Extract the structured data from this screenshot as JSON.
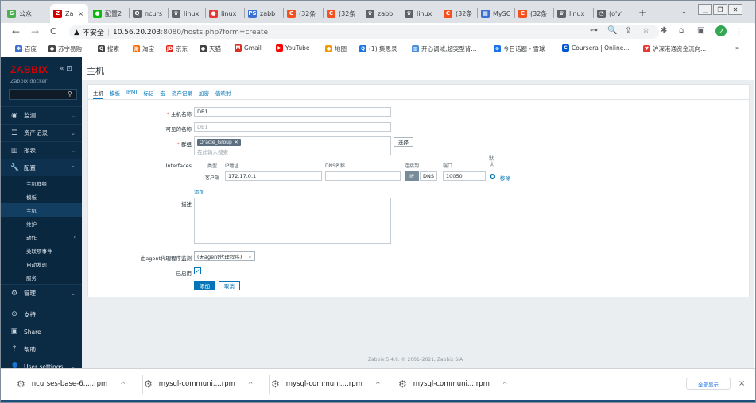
{
  "browser": {
    "tabs": [
      {
        "label": "公众",
        "fav": "G",
        "color": "#4caf50"
      },
      {
        "label": "Za",
        "fav": "Z",
        "color": "#d40000",
        "active": true
      },
      {
        "label": "配置2",
        "fav": "●",
        "color": "#09bb07"
      },
      {
        "label": "ncurs",
        "fav": "Q",
        "color": "#5f6368"
      },
      {
        "label": "linux",
        "fav": "♛",
        "color": "#5f6368"
      },
      {
        "label": "linux",
        "fav": "●",
        "color": "#e53935"
      },
      {
        "label": "zabb",
        "fav": "PS",
        "color": "#3b6fd4"
      },
      {
        "label": "(32条",
        "fav": "C",
        "color": "#f4511e"
      },
      {
        "label": "(32条",
        "fav": "C",
        "color": "#f4511e"
      },
      {
        "label": "zabb",
        "fav": "♛",
        "color": "#5f6368"
      },
      {
        "label": "linux",
        "fav": "♛",
        "color": "#5f6368"
      },
      {
        "label": "(32条",
        "fav": "C",
        "color": "#f4511e"
      },
      {
        "label": "MySC",
        "fav": "▦",
        "color": "#3b6fd4"
      },
      {
        "label": "(32条",
        "fav": "C",
        "color": "#f4511e"
      },
      {
        "label": "linux",
        "fav": "♛",
        "color": "#5f6368"
      },
      {
        "label": "(o'v'",
        "fav": "◔",
        "color": "#5f6368"
      }
    ],
    "tab_close": "×",
    "new_tab": "+",
    "tab_list": "⌄",
    "window_controls": [
      "▁",
      "❐",
      "✕"
    ],
    "nav": {
      "back": "←",
      "forward": "→",
      "reload": "C"
    },
    "security_label": "不安全",
    "url_host": "10.56.20.203",
    "url_path": ":8080/hosts.php?form=create",
    "toolbar_icons": [
      "⊶",
      "🔍",
      "⇪",
      "☆",
      "✱",
      "⌂",
      "▣"
    ],
    "profile_initial": "2",
    "menu": "⋮",
    "bookmarks": [
      {
        "label": "百度",
        "fav": "✽",
        "color": "#3b6fd4"
      },
      {
        "label": "苏宁易购",
        "fav": "●",
        "color": "#444"
      },
      {
        "label": "搜索",
        "fav": "Q",
        "color": "#444"
      },
      {
        "label": "淘宝",
        "fav": "淘",
        "color": "#ff6a00"
      },
      {
        "label": "京东",
        "fav": "JD",
        "color": "#e1251b"
      },
      {
        "label": "天猫",
        "fav": "●",
        "color": "#444"
      },
      {
        "label": "Gmail",
        "fav": "M",
        "color": "#d93025"
      },
      {
        "label": "YouTube",
        "fav": "▶",
        "color": "#ff0000"
      },
      {
        "label": "地图",
        "fav": "●",
        "color": "#f29900"
      },
      {
        "label": "(1) 集思录",
        "fav": "Q",
        "color": "#1a73e8"
      },
      {
        "label": "开心调域,超突型背...",
        "fav": "▥",
        "color": "#4a90d9"
      },
      {
        "label": "今日话题 - 雪球",
        "fav": "⊛",
        "color": "#1a73e8"
      },
      {
        "label": "Coursera | Online...",
        "fav": "C",
        "color": "#0056d2"
      },
      {
        "label": "沪深港通资金流向...",
        "fav": "♥",
        "color": "#e53935"
      }
    ],
    "bookmarks_more": "»"
  },
  "zabbix": {
    "logo": "ZABBIX",
    "sidebar_controls": "« ⊡",
    "server_name": "Zabbix docker",
    "search_icon": "⚲",
    "menu": [
      {
        "label": "监测",
        "icon": "◉"
      },
      {
        "label": "资产记录",
        "icon": "☰"
      },
      {
        "label": "报表",
        "icon": "▥"
      },
      {
        "label": "配置",
        "icon": "🔧"
      }
    ],
    "chev_down": "⌄",
    "chev_up": "⌃",
    "chev_right": "›",
    "config_sub": [
      "主机群组",
      "模板",
      "主机",
      "维护",
      "动作",
      "关联项事件",
      "自动发现",
      "服务"
    ],
    "admin": {
      "label": "管理",
      "icon": "⚙"
    },
    "bottom": [
      {
        "label": "支持",
        "icon": "⊙"
      },
      {
        "label": "Share",
        "icon": "▣"
      },
      {
        "label": "帮助",
        "icon": "?"
      },
      {
        "label": "User settings",
        "icon": "👤"
      }
    ],
    "page_title": "主机",
    "tabs": [
      "主机",
      "模板",
      "IPMI",
      "标记",
      "宏",
      "资产记录",
      "加密",
      "值映射"
    ],
    "form": {
      "host_name_label": "主机名称",
      "host_name_value": "DB1",
      "visible_name_label": "可见的名称",
      "visible_name_value": "DB1",
      "groups_label": "群组",
      "group_chip": "Oracle_Group",
      "chip_remove": "✕",
      "groups_placeholder": "在此输入搜索",
      "select_button": "选择",
      "interfaces_label": "Interfaces",
      "col_type": "类型",
      "col_ip": "IP地址",
      "col_dns": "DNS名称",
      "col_connect": "连接到",
      "col_port": "端口",
      "col_default": "默认",
      "iface_type": "客户端",
      "iface_ip": "172.17.0.1",
      "iface_dns": "",
      "ip_toggle": "IP",
      "dns_toggle": "DNS",
      "iface_port": "10050",
      "remove_link": "移除",
      "add_link": "添加",
      "description_label": "描述",
      "description_value": "",
      "proxy_label": "由agent代理程序监测",
      "proxy_value": "(无agent代理程序)",
      "enabled_label": "已启用",
      "enabled_check": "✓",
      "add_button": "添加",
      "cancel_button": "取消"
    },
    "footer": "Zabbix 5.4.9. © 2001–2021, Zabbix SIA"
  },
  "downloads": {
    "items": [
      "ncurses-base-6.....rpm",
      "mysql-communi....rpm",
      "mysql-communi....rpm",
      "mysql-communi....rpm"
    ],
    "file_icon": "⚙",
    "caret": "^",
    "show_all": "全部显示",
    "close": "×"
  },
  "colors": {
    "sidebar_bg": "#0b2a44",
    "accent": "#0275b8",
    "logo_red": "#d40000"
  }
}
